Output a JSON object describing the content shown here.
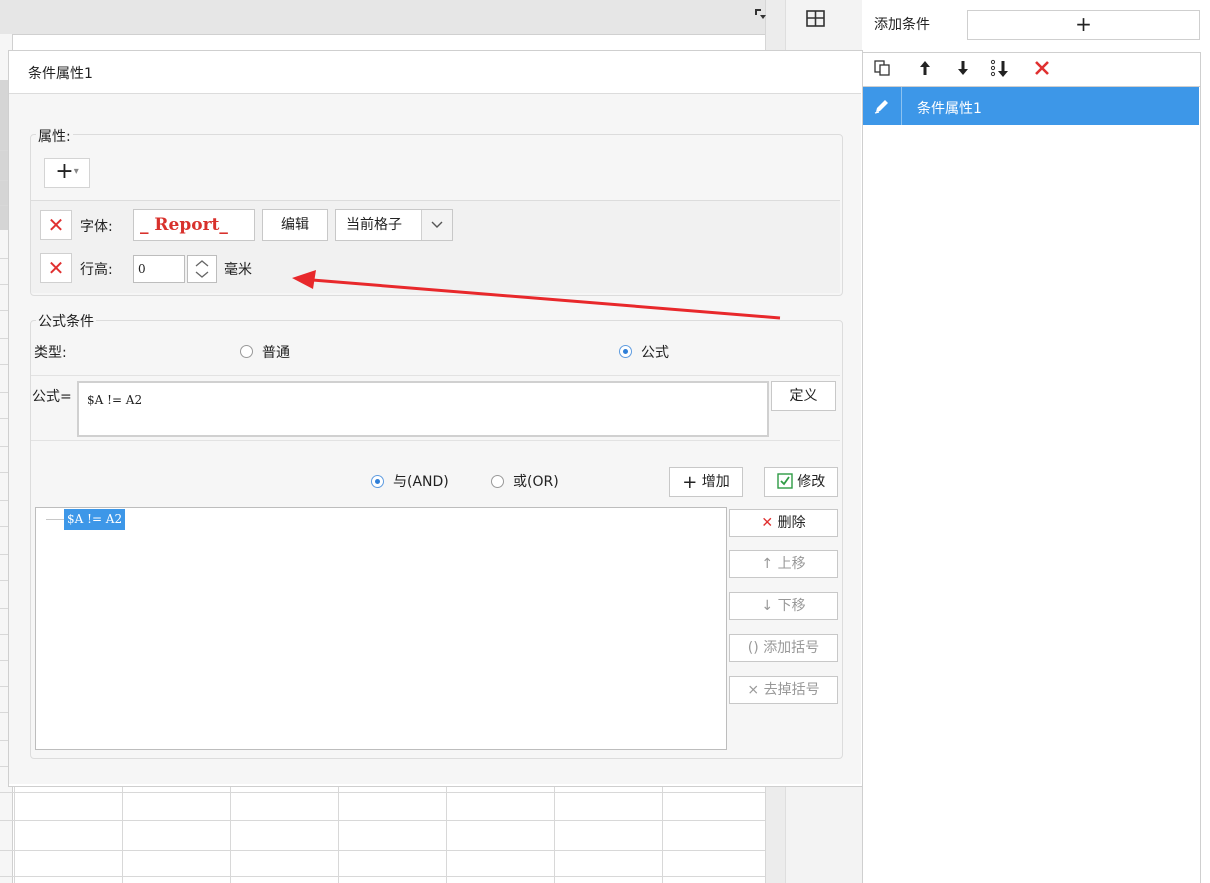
{
  "right_panel": {
    "add_condition_label": "添加条件",
    "add_button_label": "+",
    "toolbar_icons": [
      "copy-icon",
      "arrow-up-icon",
      "arrow-down-icon",
      "move-bottom-icon",
      "delete-icon"
    ],
    "conditions": [
      {
        "label": "条件属性1",
        "icon": "pencil-icon",
        "selected": true
      }
    ]
  },
  "dialog": {
    "title": "条件属性1",
    "properties": {
      "group_label": "属性:",
      "add_button": "+",
      "font_row": {
        "label": "字体:",
        "font_sample": "_ Report_",
        "edit_button": "编辑",
        "scope_select": "当前格子"
      },
      "row_height_row": {
        "label": "行高:",
        "value": "0",
        "unit": "毫米"
      }
    },
    "formula_condition": {
      "group_label": "公式条件",
      "type_label": "类型:",
      "type_options": [
        {
          "label": "普通",
          "selected": false
        },
        {
          "label": "公式",
          "selected": true
        }
      ],
      "formula_label": "公式=",
      "formula_value": "$A != A2",
      "define_button": "定义",
      "logic_options": [
        {
          "label": "与(AND)",
          "selected": true
        },
        {
          "label": "或(OR)",
          "selected": false
        }
      ],
      "add_button": "增加",
      "modify_button": "修改",
      "tree_items": [
        "$A != A2"
      ],
      "side_buttons": {
        "delete": "删除",
        "move_up": "上移",
        "move_down": "下移",
        "add_bracket": "添加括号",
        "remove_bracket": "去掉括号"
      }
    }
  },
  "colors": {
    "accent": "#3d97e8",
    "danger": "#e03030",
    "annotation_arrow": "#e8282b"
  }
}
